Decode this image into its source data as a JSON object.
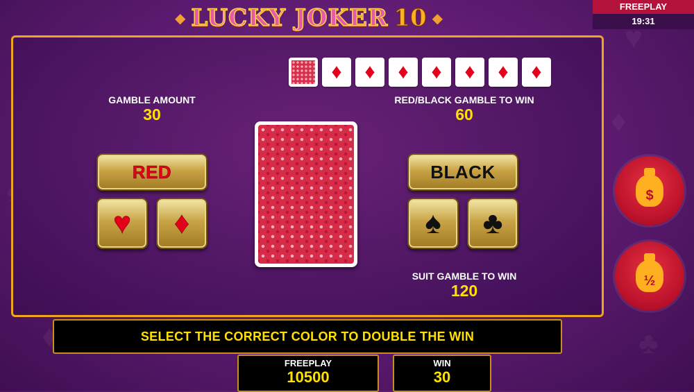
{
  "header": {
    "game_title": "LUCKY JOKER",
    "game_number": "10"
  },
  "clock": {
    "mode": "FREEPLAY",
    "time": "19:31"
  },
  "history": {
    "cards": [
      "back",
      "diamond",
      "diamond",
      "diamond",
      "diamond",
      "diamond",
      "diamond",
      "diamond"
    ],
    "suit_glyph": "♦"
  },
  "gamble": {
    "amount_label": "GAMBLE AMOUNT",
    "amount_value": "30",
    "color_win_label": "RED/BLACK GAMBLE TO WIN",
    "color_win_value": "60",
    "suit_win_label": "SUIT GAMBLE TO WIN",
    "suit_win_value": "120"
  },
  "buttons": {
    "red_label": "RED",
    "black_label": "BLACK",
    "hearts_glyph": "♥",
    "diamonds_glyph": "♦",
    "spades_glyph": "♠",
    "clubs_glyph": "♣"
  },
  "message": "SELECT THE CORRECT COLOR TO DOUBLE THE WIN",
  "footer": {
    "credit_label": "FREEPLAY",
    "credit_value": "10500",
    "win_label": "WIN",
    "win_value": "30"
  },
  "side_buttons": {
    "collect_symbol": "$",
    "half_symbol": "½"
  },
  "colors": {
    "accent_gold": "#f0a51e",
    "suit_red": "#e3001b",
    "value_yellow": "#ffe000"
  }
}
